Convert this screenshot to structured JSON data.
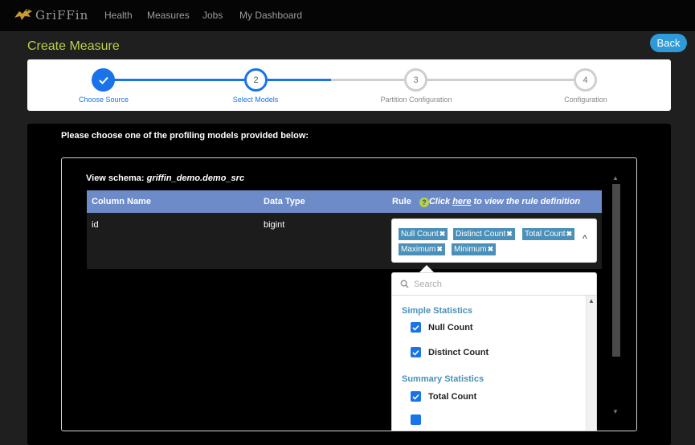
{
  "nav": {
    "brand": "GriFFin",
    "items": [
      "Health",
      "Measures",
      "Jobs",
      "My Dashboard"
    ]
  },
  "page": {
    "title": "Create Measure",
    "back_label": "Back"
  },
  "steps": [
    {
      "number": "",
      "label": "Choose Source",
      "state": "done"
    },
    {
      "number": "2",
      "label": "Select Models",
      "state": "active"
    },
    {
      "number": "3",
      "label": "Partition Configuration",
      "state": "pending"
    },
    {
      "number": "4",
      "label": "Configuration",
      "state": "pending"
    }
  ],
  "panel": {
    "instruction": "Please choose one of the profiling models provided below:",
    "schema_label": "View schema:",
    "schema_name": "griffin_demo.demo_src"
  },
  "table": {
    "headers": {
      "column": "Column Name",
      "type": "Data Type",
      "rule": "Rule",
      "help_icon": "?",
      "hint_prefix": "Click ",
      "hint_link": "here",
      "hint_suffix": " to view the rule definition"
    },
    "row": {
      "column": "id",
      "type": "bigint"
    }
  },
  "rule_select": {
    "selected": [
      "Null Count",
      "Distinct Count",
      "Total Count",
      "Maximum",
      "Minimum"
    ],
    "remove_glyph": "✖",
    "caret": "^"
  },
  "dropdown": {
    "search_placeholder": "Search",
    "groups": [
      {
        "label": "Simple Statistics",
        "options": [
          "Null Count",
          "Distinct Count"
        ]
      },
      {
        "label": "Summary Statistics",
        "options": [
          "Total Count"
        ]
      }
    ]
  },
  "colors": {
    "accent": "#1a73e8",
    "title": "#b9d24a",
    "tag": "#4a90b8",
    "header": "#6d8bc9"
  }
}
